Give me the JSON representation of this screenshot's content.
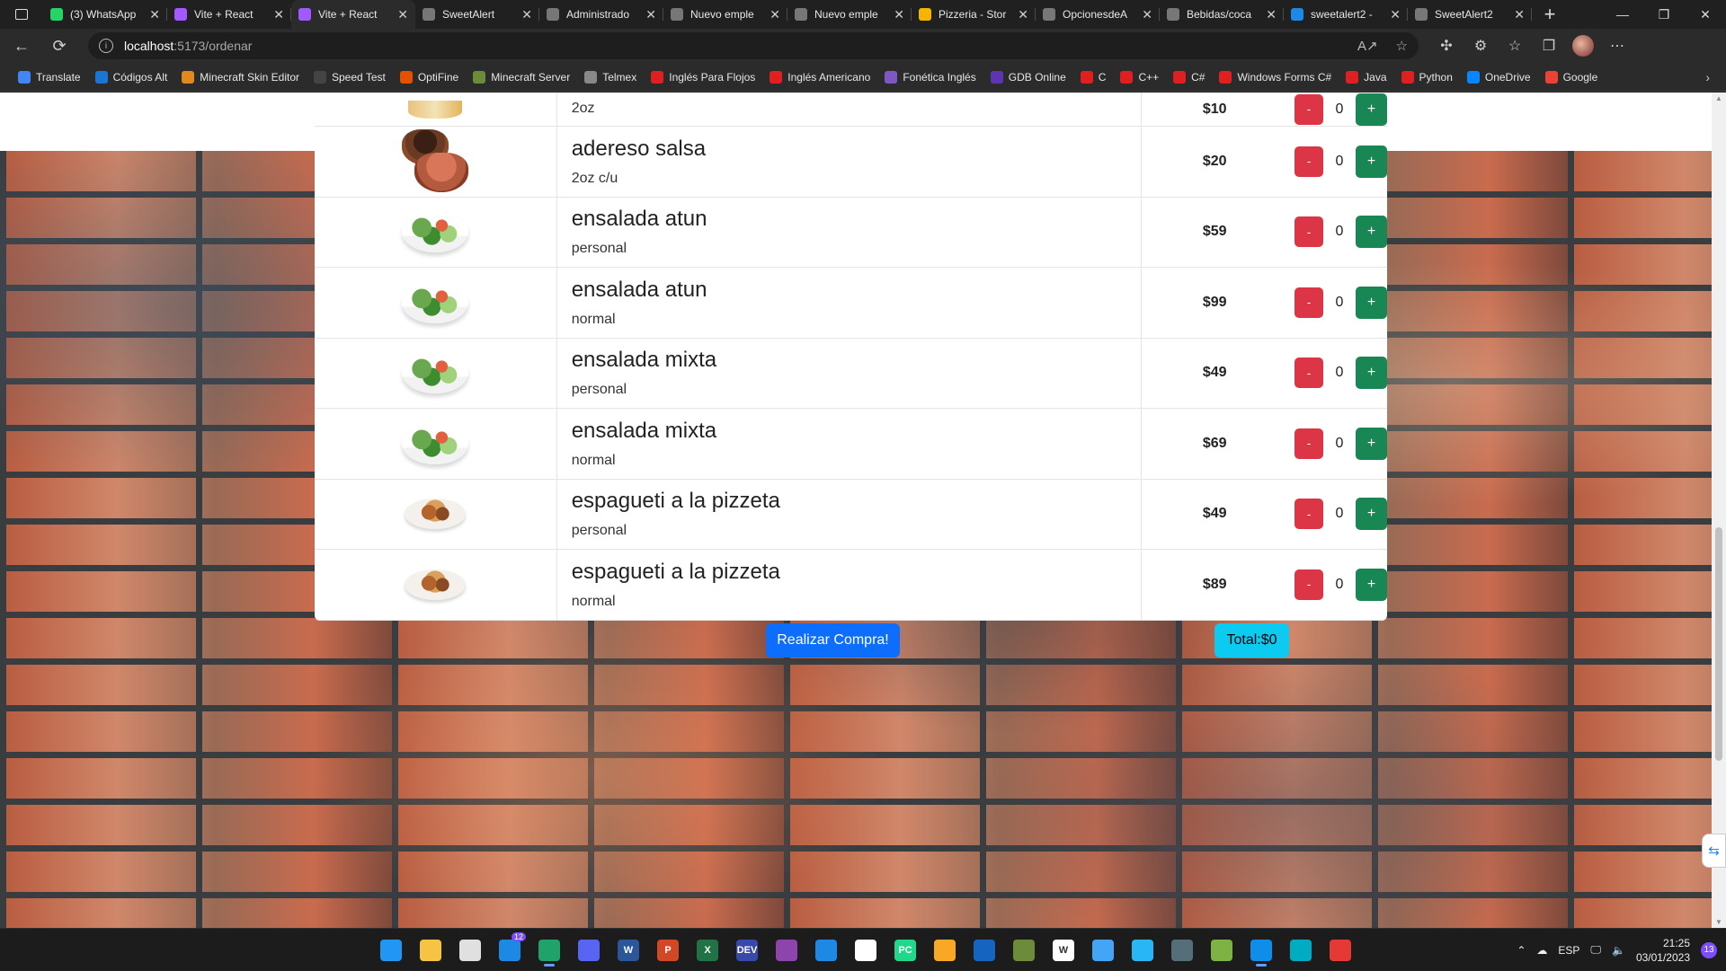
{
  "browser": {
    "tabs": [
      {
        "title": "(3) WhatsApp",
        "icon": "whatsapp-icon",
        "color": "#25d366",
        "active": false
      },
      {
        "title": "Vite + React",
        "icon": "vite-icon",
        "color": "#a259ff",
        "active": false
      },
      {
        "title": "Vite + React",
        "icon": "vite-icon",
        "color": "#a259ff",
        "active": true
      },
      {
        "title": "SweetAlert",
        "icon": "page-icon",
        "color": "#777777",
        "active": false
      },
      {
        "title": "Administrado",
        "icon": "page-icon",
        "color": "#777777",
        "active": false
      },
      {
        "title": "Nuevo emple",
        "icon": "page-icon",
        "color": "#777777",
        "active": false
      },
      {
        "title": "Nuevo emple",
        "icon": "page-icon",
        "color": "#777777",
        "active": false
      },
      {
        "title": "Pizzeria - Stor",
        "icon": "pizza-icon",
        "color": "#f5b400",
        "active": false
      },
      {
        "title": "OpcionesdeA",
        "icon": "page-icon",
        "color": "#777777",
        "active": false
      },
      {
        "title": "Bebidas/coca",
        "icon": "page-icon",
        "color": "#777777",
        "active": false
      },
      {
        "title": "sweetalert2 -",
        "icon": "search-icon",
        "color": "#1e88e5",
        "active": false
      },
      {
        "title": "SweetAlert2",
        "icon": "sweetalert-icon",
        "color": "#777777",
        "active": false
      }
    ],
    "url": {
      "host": "localhost",
      "path": ":5173/ordenar"
    },
    "favorites": [
      {
        "label": "Translate",
        "icon": "translate-icon",
        "color": "#4285f4"
      },
      {
        "label": "Códigos Alt",
        "icon": "check-icon",
        "color": "#1976d2"
      },
      {
        "label": "Minecraft Skin Editor",
        "icon": "minecraft-icon",
        "color": "#e08a1e"
      },
      {
        "label": "Speed Test",
        "icon": "speedtest-icon",
        "color": "#444444"
      },
      {
        "label": "OptiFine",
        "icon": "optifine-icon",
        "color": "#e65100"
      },
      {
        "label": "Minecraft Server",
        "icon": "cube-icon",
        "color": "#6d8c3a"
      },
      {
        "label": "Telmex",
        "icon": "page-icon",
        "color": "#888888"
      },
      {
        "label": "Inglés Para Flojos",
        "icon": "youtube-icon",
        "color": "#e02020"
      },
      {
        "label": "Inglés Americano",
        "icon": "youtube-icon",
        "color": "#e02020"
      },
      {
        "label": "Fonética Inglés",
        "icon": "fonetica-icon",
        "color": "#7e57c2"
      },
      {
        "label": "GDB Online",
        "icon": "gdb-icon",
        "color": "#5e35b1"
      },
      {
        "label": "C",
        "icon": "youtube-icon",
        "color": "#e02020"
      },
      {
        "label": "C++",
        "icon": "youtube-icon",
        "color": "#e02020"
      },
      {
        "label": "C#",
        "icon": "youtube-icon",
        "color": "#e02020"
      },
      {
        "label": "Windows Forms C#",
        "icon": "youtube-icon",
        "color": "#e02020"
      },
      {
        "label": "Java",
        "icon": "youtube-icon",
        "color": "#e02020"
      },
      {
        "label": "Python",
        "icon": "youtube-icon",
        "color": "#e02020"
      },
      {
        "label": "OneDrive",
        "icon": "onedrive-icon",
        "color": "#0a84ff"
      },
      {
        "label": "Google",
        "icon": "google-icon",
        "color": "#ea4335"
      }
    ]
  },
  "products": [
    {
      "name": "",
      "size": "2oz",
      "price": "$10",
      "qty": "0",
      "image": "top"
    },
    {
      "name": "adereso salsa",
      "size": "2oz c/u",
      "price": "$20",
      "qty": "0",
      "image": "sauce"
    },
    {
      "name": "ensalada atun",
      "size": "personal",
      "price": "$59",
      "qty": "0",
      "image": "salad"
    },
    {
      "name": "ensalada atun",
      "size": "normal",
      "price": "$99",
      "qty": "0",
      "image": "salad"
    },
    {
      "name": "ensalada mixta",
      "size": "personal",
      "price": "$49",
      "qty": "0",
      "image": "salad"
    },
    {
      "name": "ensalada mixta",
      "size": "normal",
      "price": "$69",
      "qty": "0",
      "image": "salad"
    },
    {
      "name": "espagueti a la pizzeta",
      "size": "personal",
      "price": "$49",
      "qty": "0",
      "image": "pasta"
    },
    {
      "name": "espagueti a la pizzeta",
      "size": "normal",
      "price": "$89",
      "qty": "0",
      "image": "pasta"
    }
  ],
  "controls": {
    "minus": "-",
    "plus": "+"
  },
  "actions": {
    "buy_label": "Realizar Compra!",
    "total_label": "Total:$0"
  },
  "colors": {
    "buy": "#0d6efd",
    "total": "#0dcaf0",
    "minus": "#dc3545",
    "plus": "#198754"
  },
  "taskbar": {
    "apps": [
      {
        "icon": "windows-start-icon",
        "color": "#2196f3",
        "text": ""
      },
      {
        "icon": "file-explorer-icon",
        "color": "#f6c343",
        "text": ""
      },
      {
        "icon": "store-icon",
        "color": "#e0e0e0",
        "text": ""
      },
      {
        "icon": "mail-icon",
        "color": "#1e88e5",
        "text": "",
        "badge": "12"
      },
      {
        "icon": "edge-icon",
        "color": "#1fa36a",
        "text": "",
        "active": true
      },
      {
        "icon": "discord-icon",
        "color": "#5865f2",
        "text": ""
      },
      {
        "icon": "word-icon",
        "color": "#2b579a",
        "text": "W"
      },
      {
        "icon": "powerpoint-icon",
        "color": "#d24726",
        "text": "P"
      },
      {
        "icon": "excel-icon",
        "color": "#217346",
        "text": "X"
      },
      {
        "icon": "devcpp-icon",
        "color": "#3949ab",
        "text": "DEV"
      },
      {
        "icon": "visual-studio-icon",
        "color": "#8e44ad",
        "text": ""
      },
      {
        "icon": "vscode-icon",
        "color": "#1e88e5",
        "text": ""
      },
      {
        "icon": "cube-icon",
        "color": "#ffffff",
        "text": ""
      },
      {
        "icon": "pycharm-icon",
        "color": "#21d789",
        "text": "PC"
      },
      {
        "icon": "paint-icon",
        "color": "#f9a825",
        "text": ""
      },
      {
        "icon": "sql-icon",
        "color": "#1565c0",
        "text": ""
      },
      {
        "icon": "minecraft-launcher-icon",
        "color": "#6d8c3a",
        "text": ""
      },
      {
        "icon": "wordpad-icon",
        "color": "#ffffff",
        "text": "W"
      },
      {
        "icon": "globe-icon",
        "color": "#42a5f5",
        "text": ""
      },
      {
        "icon": "notepad-icon",
        "color": "#29b6f6",
        "text": ""
      },
      {
        "icon": "calculator-icon",
        "color": "#546e7a",
        "text": ""
      },
      {
        "icon": "minecraft-icon",
        "color": "#7cb342",
        "text": ""
      },
      {
        "icon": "teamviewer-icon",
        "color": "#0e8ee9",
        "text": "",
        "active": true
      },
      {
        "icon": "edge-dev-icon",
        "color": "#00acc1",
        "text": ""
      },
      {
        "icon": "snipping-icon",
        "color": "#e53935",
        "text": ""
      }
    ],
    "language": "ESP",
    "time": "21:25",
    "date": "03/01/2023",
    "notifications": "13"
  }
}
